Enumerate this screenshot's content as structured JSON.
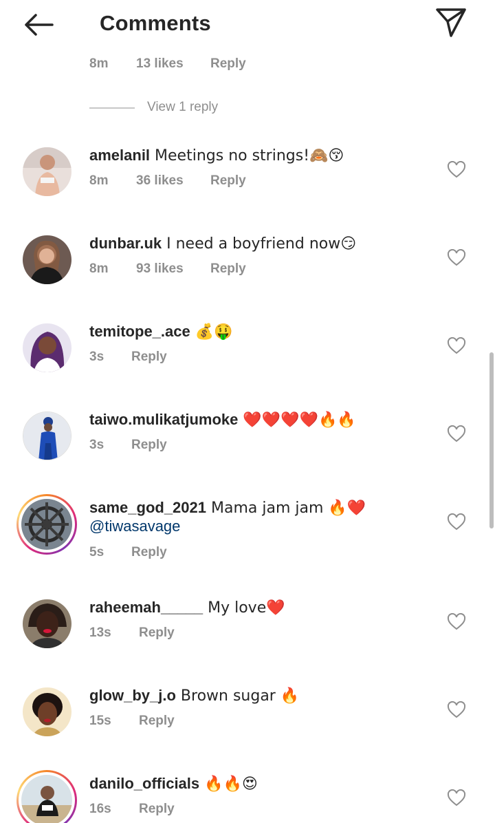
{
  "header": {
    "title": "Comments",
    "back_icon": "arrow-left-icon",
    "send_icon": "paper-plane-icon"
  },
  "top_partial": {
    "time": "8m",
    "likes": "13 likes",
    "reply": "Reply"
  },
  "view_replies": "View 1 reply",
  "comments": [
    {
      "user": "amelanil",
      "text": " Meetings no strings!🙈😚",
      "time": "8m",
      "likes": "36 likes",
      "reply": "Reply"
    },
    {
      "user": "dunbar.uk",
      "text": " I need a boyfriend now😏",
      "time": "8m",
      "likes": "93 likes",
      "reply": "Reply"
    },
    {
      "user": "temitope_.ace",
      "text": " 💰🤑",
      "time": "3s",
      "reply": "Reply"
    },
    {
      "user": "taiwo.mulikatjumoke",
      "text": " ❤️❤️❤️❤️🔥🔥",
      "time": "3s",
      "reply": "Reply"
    },
    {
      "user": "same_god_2021",
      "text": " Mama jam jam 🔥❤️",
      "mention": "@tiwasavage",
      "time": "5s",
      "reply": "Reply"
    },
    {
      "user": "raheemah_____",
      "text": " My love❤️",
      "time": "13s",
      "reply": "Reply"
    },
    {
      "user": "glow_by_j.o",
      "text": " Brown sugar 🔥",
      "time": "15s",
      "reply": "Reply"
    },
    {
      "user": "danilo_officials",
      "text": " 🔥🔥😍",
      "time": "16s",
      "reply": "Reply"
    }
  ],
  "colors": {
    "text": "#262626",
    "meta": "#8e8e8e",
    "mention": "#00376b",
    "divider": "#c7c7c7"
  }
}
